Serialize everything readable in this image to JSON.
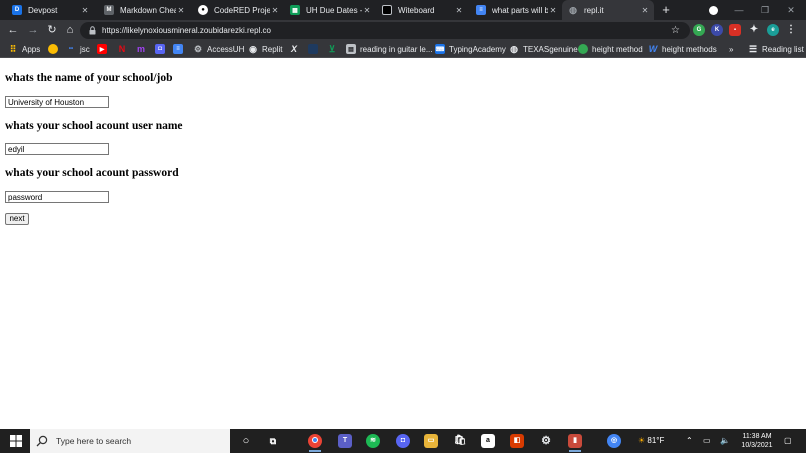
{
  "tabs": [
    {
      "title": "Devpost",
      "icon": "devpost-icon",
      "letter": "D",
      "color": "#1a73e8",
      "active": false
    },
    {
      "title": "Markdown Cheat",
      "icon": "markdown-icon",
      "letter": "",
      "color": "#5f6368",
      "active": false
    },
    {
      "title": "CodeRED Project",
      "icon": "github-icon",
      "letter": "",
      "color": "#ffffff",
      "active": false
    },
    {
      "title": "UH Due Dates - G",
      "icon": "sheets-icon",
      "letter": "",
      "color": "#0f9d58",
      "active": false
    },
    {
      "title": "Witeboard",
      "icon": "witeboard-icon",
      "letter": "",
      "color": "#000000",
      "active": false
    },
    {
      "title": "what parts will be",
      "icon": "docs-icon",
      "letter": "",
      "color": "#4285f4",
      "active": false
    },
    {
      "title": "repl.it",
      "icon": "globe-icon",
      "letter": "",
      "color": "#9aa0a6",
      "active": true
    }
  ],
  "address": {
    "url": "https://likelynoxiousmineral.zoubidarezki.repl.co"
  },
  "bookmarks": [
    {
      "label": "Apps",
      "icon": "apps-grid-icon",
      "color": "#fbbc04"
    },
    {
      "label": "",
      "icon": "smiley-icon",
      "color": "#fbbc04"
    },
    {
      "label": "jsc",
      "icon": "jsc-icon",
      "color": "#4285f4"
    },
    {
      "label": "",
      "icon": "youtube-icon",
      "color": "#ff0000"
    },
    {
      "label": "",
      "icon": "netflix-icon",
      "color": "#e50914"
    },
    {
      "label": "",
      "icon": "m-icon",
      "color": "#a142f4"
    },
    {
      "label": "",
      "icon": "discord-icon",
      "color": "#5865f2"
    },
    {
      "label": "",
      "icon": "docs-icon",
      "color": "#4285f4"
    },
    {
      "label": "AccessUH",
      "icon": "accessuh-icon",
      "color": "#5f6368"
    },
    {
      "label": "Replit",
      "icon": "replit-icon",
      "color": "#e8eaed"
    },
    {
      "label": "",
      "icon": "x-icon",
      "color": "#e8eaed"
    },
    {
      "label": "",
      "icon": "dark-icon",
      "color": "#1e3a5f"
    },
    {
      "label": "",
      "icon": "sheets-icon",
      "color": "#0f9d58"
    },
    {
      "label": "reading in guitar le...",
      "icon": "guitar-icon",
      "color": "#bdc1c6"
    },
    {
      "label": "TypingAcademy",
      "icon": "typing-icon",
      "color": "#1a73e8"
    },
    {
      "label": "TEXASgenuine",
      "icon": "globe-icon",
      "color": "#e8eaed"
    },
    {
      "label": "height method",
      "icon": "height-icon",
      "color": "#34a853"
    },
    {
      "label": "height methods",
      "icon": "wikipedia-icon",
      "color": "#4285f4"
    },
    {
      "label": "Reading list",
      "icon": "reading-list-icon",
      "color": "#e8eaed"
    }
  ],
  "form": {
    "q1": "whats the name of your school/job",
    "a1": "University of Houston",
    "q2": "whats your school acount user name",
    "a2": "edyil",
    "q3": "whats your school acount password",
    "a3": "password",
    "next": "next"
  },
  "taskbar": {
    "search_placeholder": "Type here to search",
    "weather": "81°F",
    "time": "11:38 AM",
    "date": "10/3/2021"
  },
  "colors": {
    "tabstrip": "#202124",
    "toolbar": "#35363a",
    "taskbar": "#202020"
  }
}
